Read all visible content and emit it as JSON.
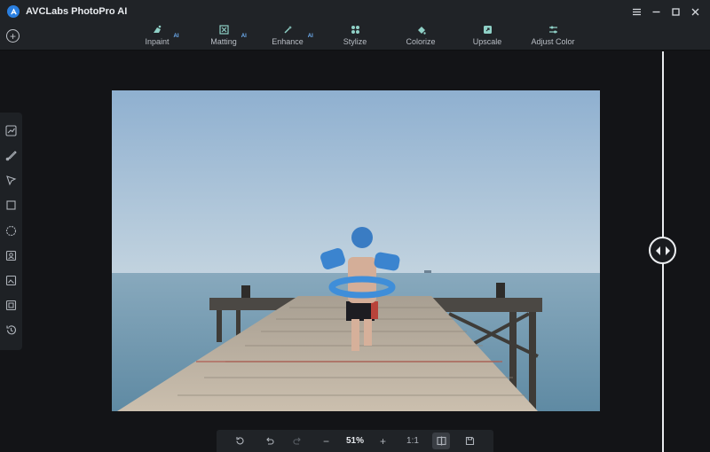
{
  "app": {
    "title": "AVCLabs PhotoPro AI"
  },
  "window_controls": [
    "menu-icon",
    "minimize-icon",
    "maximize-icon",
    "close-icon"
  ],
  "toolbar": {
    "add_icon": "plus-circle-icon",
    "tools": [
      {
        "label": "Inpaint",
        "ai": "AI",
        "icon": "inpaint-icon"
      },
      {
        "label": "Matting",
        "ai": "AI",
        "icon": "matting-icon"
      },
      {
        "label": "Enhance",
        "ai": "AI",
        "icon": "enhance-icon"
      },
      {
        "label": "Stylize",
        "ai": "",
        "icon": "stylize-icon"
      },
      {
        "label": "Colorize",
        "ai": "",
        "icon": "colorize-icon"
      },
      {
        "label": "Upscale",
        "ai": "",
        "icon": "upscale-icon"
      },
      {
        "label": "Adjust Color",
        "ai": "",
        "icon": "adjust-color-icon"
      }
    ]
  },
  "side_tools": [
    "chart-icon",
    "brush-icon",
    "cursor-icon",
    "rectangle-icon",
    "circle-icon",
    "portrait-icon",
    "image-icon",
    "layers-icon",
    "history-icon"
  ],
  "bottom_bar": {
    "reset_icon": "reset-icon",
    "undo_icon": "undo-icon",
    "redo_icon": "redo-icon",
    "zoom_out": "−",
    "zoom": "51%",
    "zoom_in": "+",
    "actual_size": "1:1",
    "compare_icon": "compare-icon",
    "save_icon": "save-icon"
  },
  "colors": {
    "background": "#131417",
    "panel": "#202327",
    "accent": "#2a7fe0"
  }
}
